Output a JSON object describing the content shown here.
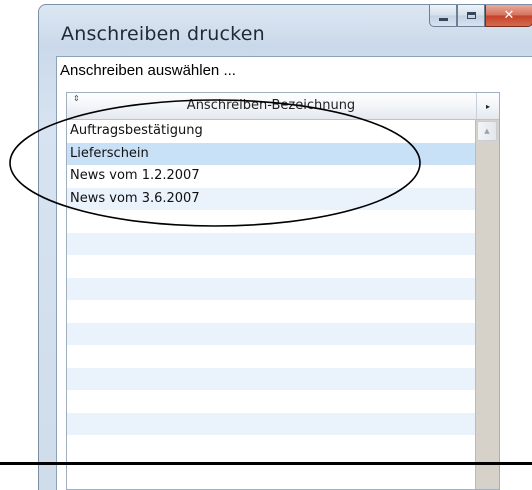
{
  "window": {
    "title": "Anschreiben drucken",
    "buttons": {
      "minimize": "minimize-icon",
      "maximize": "maximize-icon",
      "close": "close-icon",
      "close_glyph": "✕"
    }
  },
  "dialog": {
    "prompt": "Anschreiben auswählen ...",
    "grid": {
      "column_header": "Anschreiben-Bezeichnung",
      "sort_glyph": "⇕",
      "column_menu_glyph": "▸",
      "scroll_up_glyph": "▲",
      "rows": [
        "Auftragsbestätigung",
        "Lieferschein",
        "News vom 1.2.2007",
        "News vom 3.6.2007",
        "",
        "",
        "",
        "",
        "",
        "",
        "",
        "",
        "",
        "",
        ""
      ],
      "selected_row": 1
    }
  },
  "colors": {
    "selection": "#c8e1f7",
    "alt_row": "#eaf2fb",
    "close_button": "#c4412a"
  }
}
